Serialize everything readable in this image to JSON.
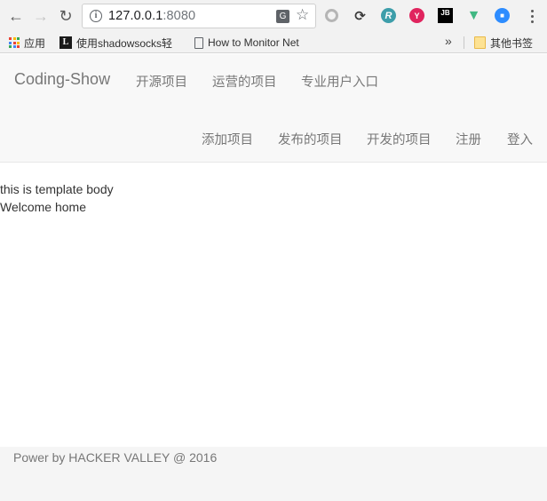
{
  "browser": {
    "url_host": "127.0.0.1",
    "url_port": ":8080",
    "bookmarks": [
      {
        "label": "应用",
        "icon": "apps-grid-icon"
      },
      {
        "label": "使用shadowsocks轻",
        "icon": "l-logo-icon"
      },
      {
        "label": "How to Monitor Net",
        "icon": "page-icon"
      }
    ],
    "more_bookmarks": "»",
    "other_bookmarks": "其他书签",
    "extensions": [
      "grey-circle-extension-icon",
      "sync-extension-icon",
      "r-extension-icon",
      "y-extension-icon",
      "jetbrains-extension-icon",
      "vue-devtools-icon",
      "zoom-extension-icon"
    ]
  },
  "navbar": {
    "brand": "Coding-Show",
    "links_row1": [
      "开源项目",
      "运营的项目",
      "专业用户入口"
    ],
    "links_row2": [
      "添加项目",
      "发布的项目",
      "开发的项目",
      "注册",
      "登入"
    ]
  },
  "content": {
    "line1": "this is template body",
    "line2": "Welcome home"
  },
  "footer": {
    "text": "Power by HACKER VALLEY @ 2016"
  },
  "colors": {
    "navbar_bg": "#f8f8f8",
    "link": "#777777",
    "footer_bg": "#f5f5f5"
  }
}
